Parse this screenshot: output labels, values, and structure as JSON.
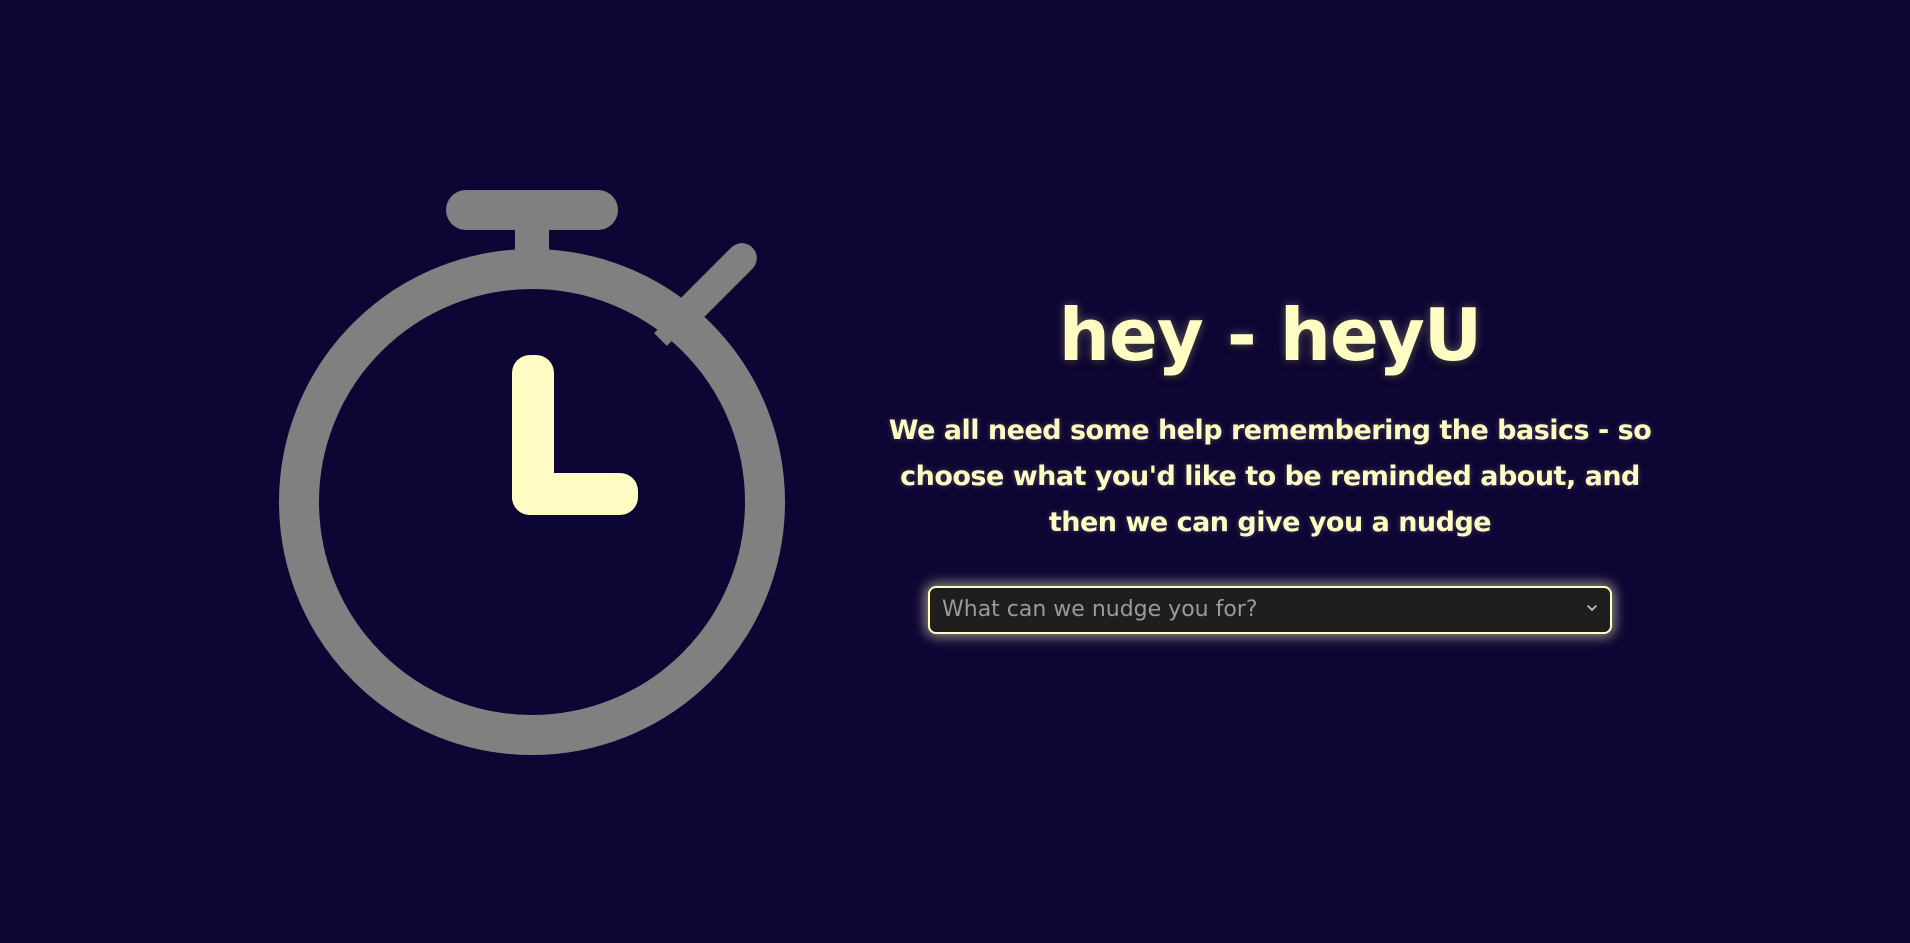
{
  "header": {
    "title": "hey - heyU",
    "subtitle": "We all need some help remembering the basics - so choose what you'd like to be reminded about, and then we can give you a nudge"
  },
  "reminder_select": {
    "placeholder": "What can we nudge you for?"
  },
  "icons": {
    "hero": "stopwatch-icon",
    "dropdown": "chevron-down-icon"
  },
  "colors": {
    "background": "#0d0533",
    "accent": "#fffdc4",
    "stopwatch": "#808080",
    "select_background": "#1e1e1e",
    "placeholder": "#9a9a9a"
  }
}
